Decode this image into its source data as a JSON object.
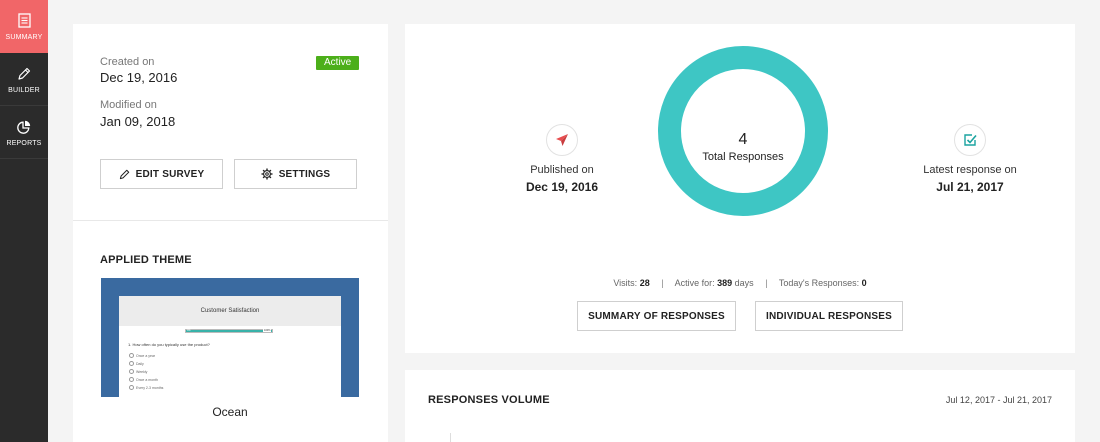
{
  "sidebar": {
    "items": [
      {
        "label": "SUMMARY",
        "icon": "document-icon",
        "active": true
      },
      {
        "label": "BUILDER",
        "icon": "pencil-icon",
        "active": false
      },
      {
        "label": "REPORTS",
        "icon": "pie-chart-icon",
        "active": false
      }
    ]
  },
  "survey": {
    "created_label": "Created on",
    "created_value": "Dec 19, 2016",
    "modified_label": "Modified on",
    "modified_value": "Jan 09, 2018",
    "status": "Active",
    "edit_label": "EDIT SURVEY",
    "settings_label": "SETTINGS"
  },
  "theme": {
    "title": "APPLIED THEME",
    "name": "Ocean",
    "preview": {
      "survey_title": "Customer Satisfaction",
      "progress_start": "0%",
      "progress_end": "100%",
      "question": "1. How often do you typically use the product?",
      "options": [
        "Once a year",
        "Daily",
        "Weekly",
        "Once a month",
        "Every 2-3 months"
      ]
    }
  },
  "stats": {
    "published_label": "Published on",
    "published_value": "Dec 19, 2016",
    "total_responses": "4",
    "total_label": "Total Responses",
    "latest_label": "Latest response on",
    "latest_value": "Jul 21, 2017",
    "visits_label": "Visits:",
    "visits_value": "28",
    "active_label": "Active for:",
    "active_value": "389",
    "active_unit": "days",
    "today_label": "Today's Responses:",
    "today_value": "0",
    "summary_btn": "SUMMARY OF RESPONSES",
    "individual_btn": "INDIVIDUAL RESPONSES"
  },
  "volume": {
    "title": "RESPONSES VOLUME",
    "range": "Jul 12, 2017 - Jul 21, 2017"
  },
  "colors": {
    "accent": "#f16668",
    "sidebar": "#2b2b2b",
    "donut": "#3ec6c4",
    "active_badge": "#4caf1a",
    "publish_icon": "#e84d4f",
    "check_icon": "#1aa3a0"
  }
}
